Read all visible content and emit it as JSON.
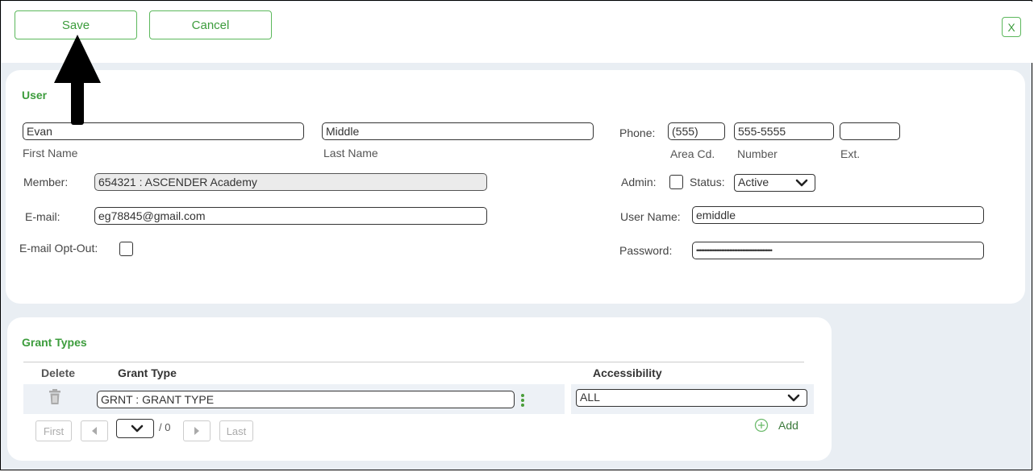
{
  "toolbar": {
    "save_label": "Save",
    "cancel_label": "Cancel",
    "close_label": "X"
  },
  "user": {
    "section_title": "User",
    "first_name": {
      "value": "Evan",
      "label": "First Name"
    },
    "last_name": {
      "value": "Middle",
      "label": "Last Name"
    },
    "member": {
      "label": "Member:",
      "value": "654321 : ASCENDER Academy"
    },
    "email": {
      "label": "E-mail:",
      "value": "eg78845@gmail.com"
    },
    "email_opt_out": {
      "label": "E-mail Opt-Out:",
      "checked": false
    },
    "phone": {
      "label": "Phone:",
      "area_code": "(555)",
      "number": "555-5555",
      "ext": "",
      "area_label": "Area Cd.",
      "number_label": "Number",
      "ext_label": "Ext."
    },
    "admin": {
      "label": "Admin:",
      "checked": false
    },
    "status": {
      "label": "Status:",
      "value": "Active"
    },
    "username": {
      "label": "User Name:",
      "value": "emiddle"
    },
    "password": {
      "label": "Password:",
      "value": "••••••••••••••••••••••••••••••••••••••••••••••••"
    }
  },
  "grant_types": {
    "section_title": "Grant Types",
    "columns": {
      "delete": "Delete",
      "grant_type": "Grant Type",
      "accessibility": "Accessibility"
    },
    "rows": [
      {
        "grant_type": "GRNT : GRANT TYPE",
        "accessibility": "ALL"
      }
    ],
    "pagination": {
      "first": "First",
      "last": "Last",
      "of_total": "/ 0"
    },
    "add_label": "Add"
  },
  "colors": {
    "accent_green": "#3c9c3c",
    "panel_background": "#e9eef3",
    "row_highlight": "#edf1f6"
  },
  "icons": [
    "trash-icon",
    "kebab-menu-icon",
    "chevron-down-icon",
    "caret-left-icon",
    "caret-right-icon",
    "add-circle-icon",
    "annotation-arrow"
  ]
}
